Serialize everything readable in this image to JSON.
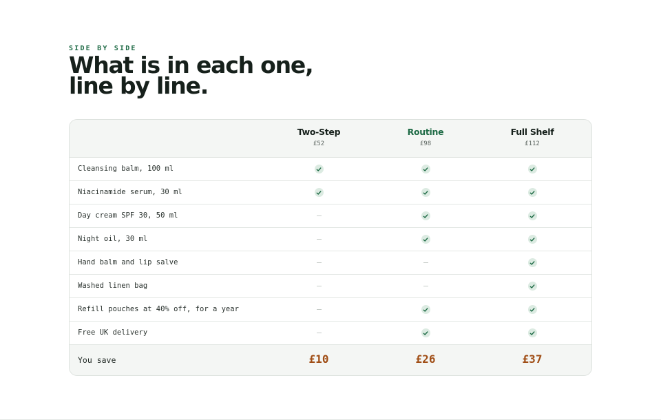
{
  "section": {
    "eyebrow": "SIDE BY SIDE",
    "headline": "What is in each one, line by line."
  },
  "plans": [
    {
      "name": "Two-Step",
      "price": "£52",
      "accent": false
    },
    {
      "name": "Routine",
      "price": "£98",
      "accent": true
    },
    {
      "name": "Full Shelf",
      "price": "£112",
      "accent": false
    }
  ],
  "rows": [
    {
      "label": "Cleansing balm, 100 ml",
      "included": [
        true,
        true,
        true
      ]
    },
    {
      "label": "Niacinamide serum, 30 ml",
      "included": [
        true,
        true,
        true
      ]
    },
    {
      "label": "Day cream SPF 30, 50 ml",
      "included": [
        false,
        true,
        true
      ]
    },
    {
      "label": "Night oil, 30 ml",
      "included": [
        false,
        true,
        true
      ]
    },
    {
      "label": "Hand balm and lip salve",
      "included": [
        false,
        false,
        true
      ]
    },
    {
      "label": "Washed linen bag",
      "included": [
        false,
        false,
        true
      ]
    },
    {
      "label": "Refill pouches at 40% off, for a year",
      "included": [
        false,
        true,
        true
      ]
    },
    {
      "label": "Free UK delivery",
      "included": [
        false,
        true,
        true
      ]
    }
  ],
  "footer": {
    "label": "You save",
    "savings": [
      "£10",
      "£26",
      "£37"
    ]
  },
  "icons": {
    "included": "check-icon",
    "not_included": "dash-icon"
  },
  "colors": {
    "accent": "#1f6b46",
    "savings": "#a04e16",
    "check_bg": "#dcebe2"
  }
}
